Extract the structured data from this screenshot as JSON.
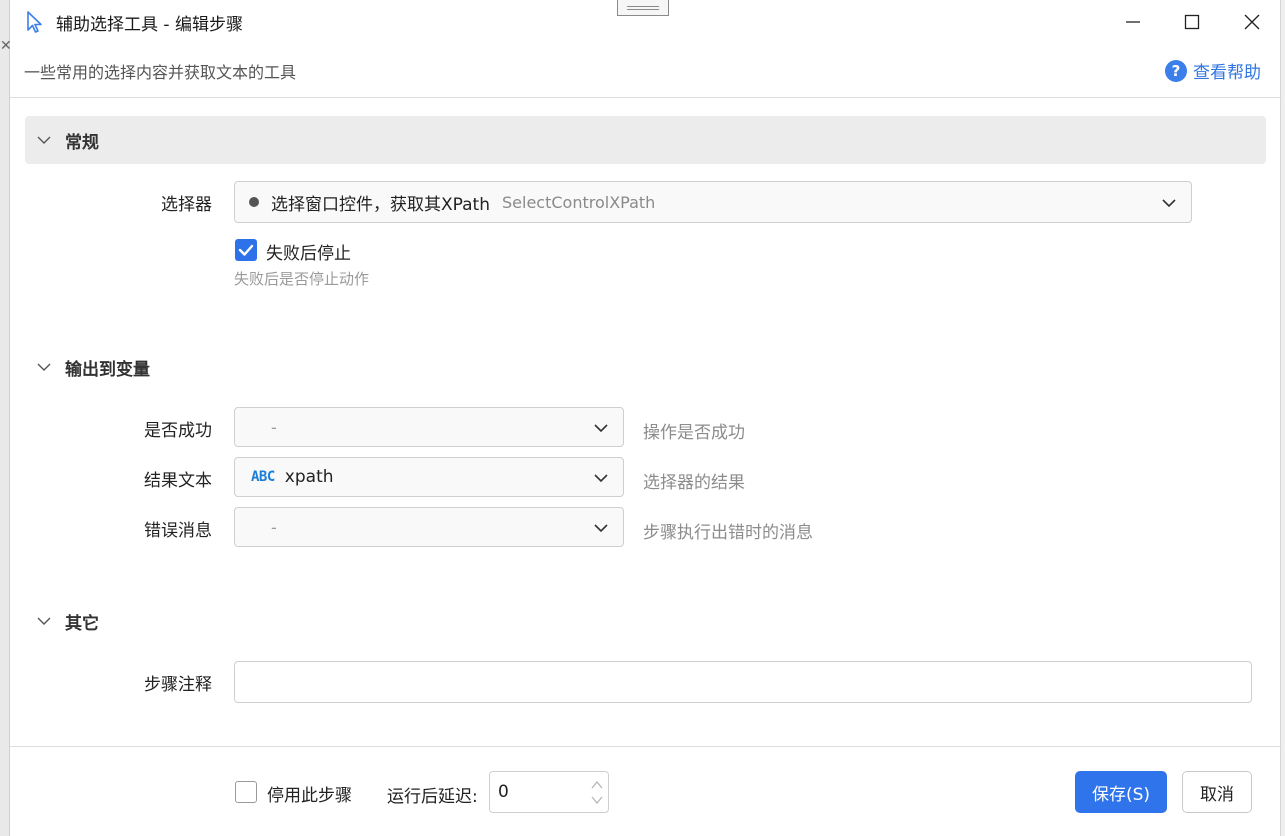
{
  "window": {
    "title": "辅助选择工具  -  编辑步骤",
    "subtitle": "一些常用的选择内容并获取文本的工具",
    "help": "查看帮助"
  },
  "sections": {
    "general": {
      "title": "常规",
      "selector_label": "选择器",
      "selector_value": "选择窗口控件，获取其XPath",
      "selector_sub": "SelectControlXPath",
      "stop_on_fail_label": "失败后停止",
      "stop_on_fail_desc": "失败后是否停止动作",
      "stop_on_fail_checked": true
    },
    "output": {
      "title": "输出到变量",
      "rows": [
        {
          "label": "是否成功",
          "value": "-",
          "hint": "操作是否成功"
        },
        {
          "label": "结果文本",
          "value": "xpath",
          "type_badge": "ABC",
          "hint": "选择器的结果"
        },
        {
          "label": "错误消息",
          "value": "-",
          "hint": "步骤执行出错时的消息"
        }
      ]
    },
    "other": {
      "title": "其它",
      "comment_label": "步骤注释",
      "comment_value": ""
    }
  },
  "footer": {
    "disable_label": "停用此步骤",
    "disable_checked": false,
    "delay_label": "运行后延迟:",
    "delay_value": "0",
    "save": "保存(S)",
    "cancel": "取消"
  },
  "colors": {
    "accent": "#2f74ea",
    "hint": "#8c8c8c"
  },
  "icons": [
    "cursor-icon",
    "minimize-icon",
    "maximize-icon",
    "close-icon",
    "help-icon",
    "chevron-down-icon",
    "check-icon",
    "spin-up-icon",
    "spin-down-icon"
  ]
}
